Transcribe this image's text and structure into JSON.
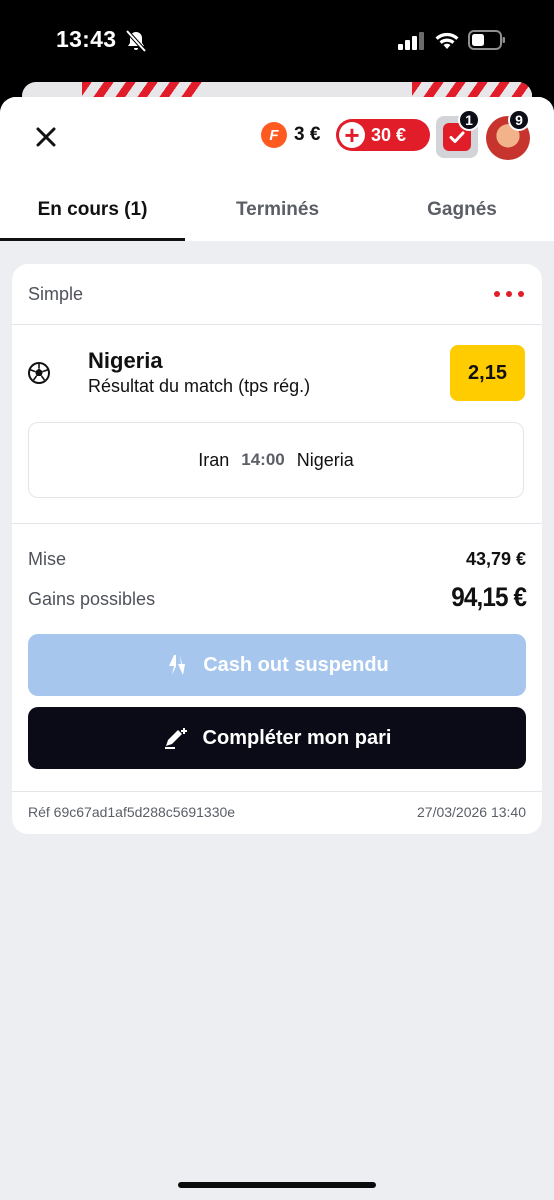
{
  "status_bar": {
    "time": "13:43",
    "icons": [
      "bell-slash-icon",
      "cellular-signal-icon",
      "wifi-icon",
      "battery-icon"
    ]
  },
  "header": {
    "close_icon": "close-icon",
    "freebet": {
      "icon_letter": "F",
      "amount": "3 €"
    },
    "deposit": {
      "plus": "+",
      "amount": "30 €"
    },
    "betslip_count": "1",
    "avatar_badge": "9"
  },
  "tabs": [
    {
      "label": "En cours (1)",
      "active": true
    },
    {
      "label": "Terminés",
      "active": false
    },
    {
      "label": "Gagnés",
      "active": false
    }
  ],
  "bet": {
    "type": "Simple",
    "selection": "Nigeria",
    "market": "Résultat du match (tps rég.)",
    "odds": "2,15",
    "match": {
      "home": "Iran",
      "time": "14:00",
      "away": "Nigeria"
    },
    "stake_label": "Mise",
    "stake_value": "43,79 €",
    "gain_label": "Gains possibles",
    "gain_value": "94,15 €",
    "cashout_label": "Cash out suspendu",
    "complete_label": "Compléter mon pari",
    "reference": "Réf 69c67ad1af5d288c5691330e",
    "date": "27/03/2026 13:40"
  },
  "colors": {
    "brand_red": "#e11d2a",
    "odds_yellow": "#ffcc00",
    "cashout_disabled": "#a6c6ee",
    "primary_dark": "#0b0b17",
    "freebet_orange": "#ff5a1f"
  }
}
